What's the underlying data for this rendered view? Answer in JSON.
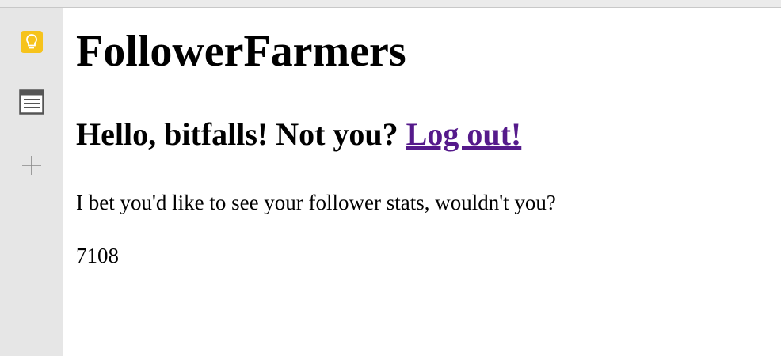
{
  "page": {
    "title": "FollowerFarmers",
    "greeting_prefix": "Hello, bitfalls! Not you?",
    "logout_link": "Log out!",
    "message": "I bet you'd like to see your follower stats, wouldn't you?",
    "follower_count": "7108"
  },
  "sidebar": {
    "icons": [
      "lightbulb-icon",
      "notes-icon",
      "add-icon"
    ]
  },
  "colors": {
    "link_visited": "#551a8b",
    "lightbulb_bg": "#f6c31c"
  }
}
